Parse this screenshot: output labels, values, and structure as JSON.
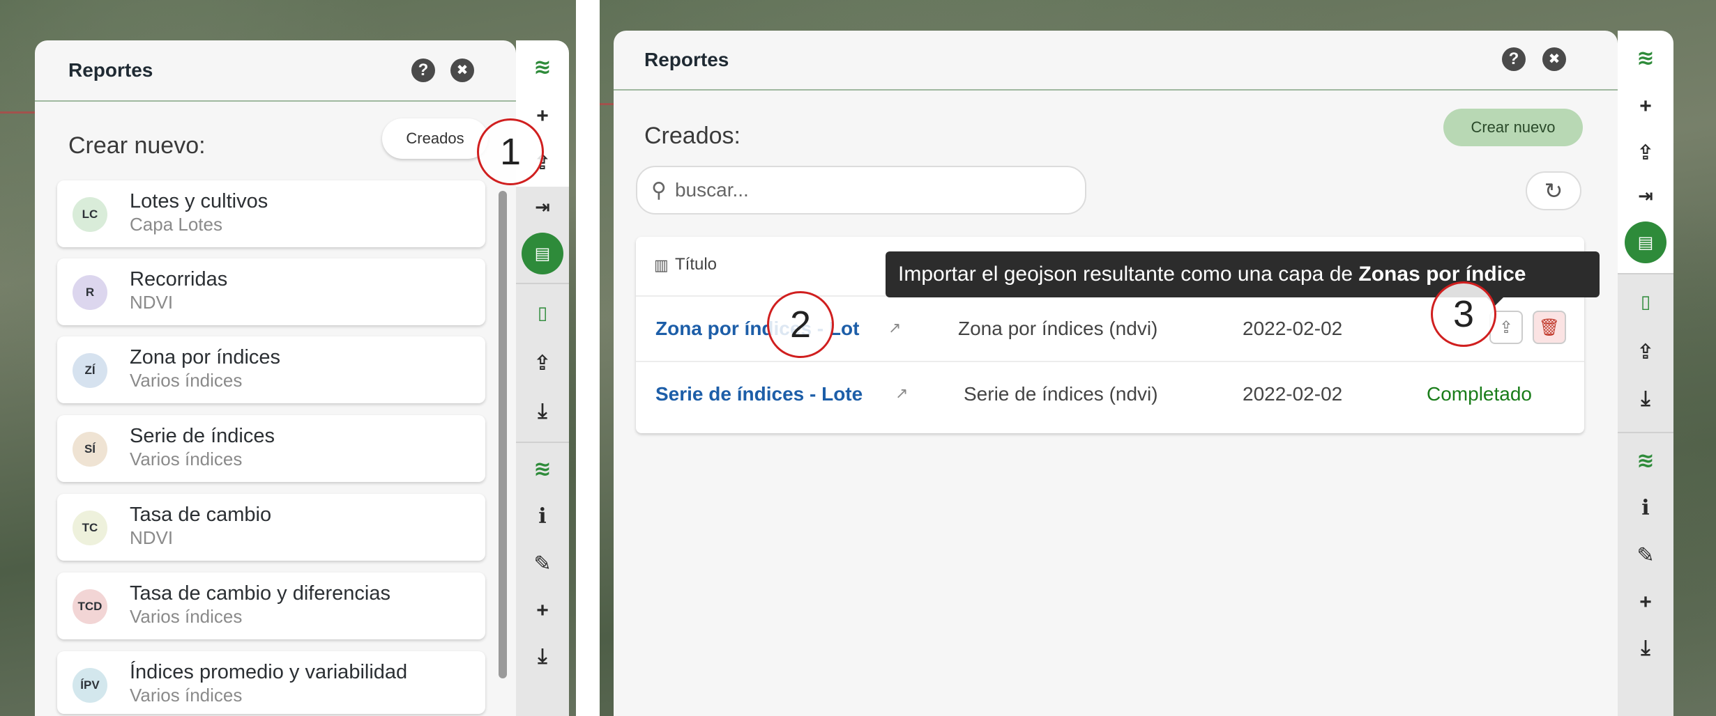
{
  "left_panel": {
    "title": "Reportes",
    "help_glyph": "?",
    "close_glyph": "✖",
    "section_label": "Crear nuevo:",
    "toggle_button": "Creados",
    "callout": "1",
    "cards": [
      {
        "abbr": "LC",
        "title": "Lotes y cultivos",
        "subtitle": "Capa Lotes",
        "color": "#d9ecd9"
      },
      {
        "abbr": "R",
        "title": "Recorridas",
        "subtitle": "NDVI",
        "color": "#dcd6ee"
      },
      {
        "abbr": "ZÍ",
        "title": "Zona por índices",
        "subtitle": "Varios índices",
        "color": "#d6e2ef"
      },
      {
        "abbr": "SÍ",
        "title": "Serie de índices",
        "subtitle": "Varios índices",
        "color": "#efe3d3"
      },
      {
        "abbr": "TC",
        "title": "Tasa de cambio",
        "subtitle": "NDVI",
        "color": "#eef1dc"
      },
      {
        "abbr": "TCD",
        "title": "Tasa de cambio y diferencias",
        "subtitle": "Varios índices",
        "color": "#f2d5d5"
      },
      {
        "abbr": "ÍPV",
        "title": "Índices promedio y variabilidad",
        "subtitle": "Varios índices",
        "color": "#d3e7ed"
      }
    ]
  },
  "right_panel": {
    "title": "Reportes",
    "help_glyph": "?",
    "close_glyph": "✖",
    "section_label": "Creados:",
    "create_button": "Crear nuevo",
    "search": {
      "placeholder": "buscar..."
    },
    "refresh_glyph": "↻",
    "table": {
      "header_title": "Título",
      "rows": [
        {
          "title": "Zona por índices - Lot",
          "type": "Zona por índices (ndvi)",
          "date": "2022-02-02",
          "status": ""
        },
        {
          "title": "Serie de índices - Lote",
          "type": "Serie de índices (ndvi)",
          "date": "2022-02-02",
          "status": "Completado"
        }
      ]
    },
    "tooltip": {
      "text": "Importar el geojson resultante como una capa de ",
      "bold": "Zonas por índice"
    },
    "callout_2": "2",
    "callout_3": "3"
  },
  "toolbar": {
    "icons": [
      "layers-icon",
      "plus-icon",
      "upload-icon",
      "import-icon",
      "report-icon",
      "mobile-icon",
      "upload-icon",
      "download-icon",
      "layers-icon",
      "info-icon",
      "pencil-icon",
      "plus-icon",
      "download-icon"
    ]
  },
  "colors": {
    "accent_green": "#2e8b3a",
    "link_blue": "#1d5ea8",
    "status_green": "#1a7d1a",
    "callout_red": "#d01f1f"
  }
}
